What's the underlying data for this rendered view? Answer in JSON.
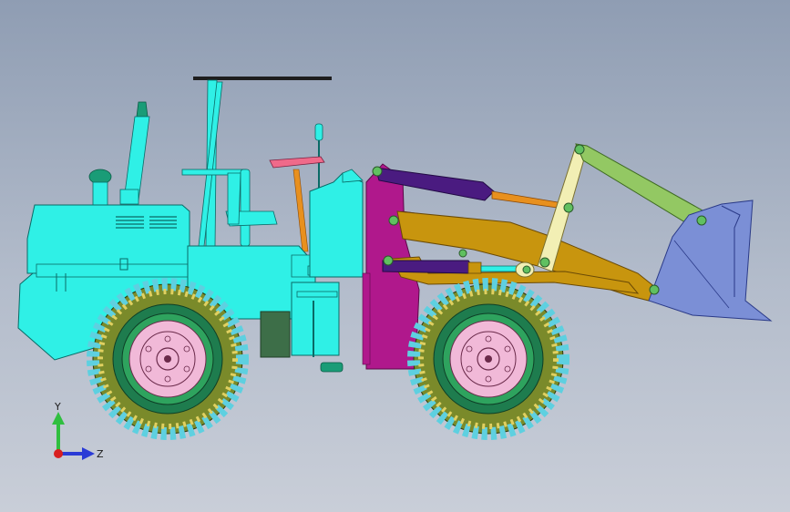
{
  "triad": {
    "y_label": "Y",
    "z_label": "Z",
    "colors": {
      "y": "#2fbf3f",
      "z": "#2a3bd6",
      "x": "#d81f1f"
    }
  },
  "colors": {
    "background_top": "#8f9db3",
    "background_bottom": "#c9ced8",
    "body": "#2ff0e6",
    "frame": "#b0188c",
    "boom": "#c8950e",
    "lift_cylinder": "#4a1b80",
    "rod": "#e8901e",
    "link": "#f2efb4",
    "link_arm": "#93c863",
    "bucket": "#7b8fd6",
    "tire_ring": "#1e7c4e",
    "rim": "#f1b9d8",
    "canopy_bar": "#222222",
    "seat": "#ef6a8a",
    "exhaust_cap": "#1a9c77",
    "panel_dark": "#3d6e48",
    "pin": "#60c060"
  },
  "icons": [
    "axis-triad-icon"
  ]
}
